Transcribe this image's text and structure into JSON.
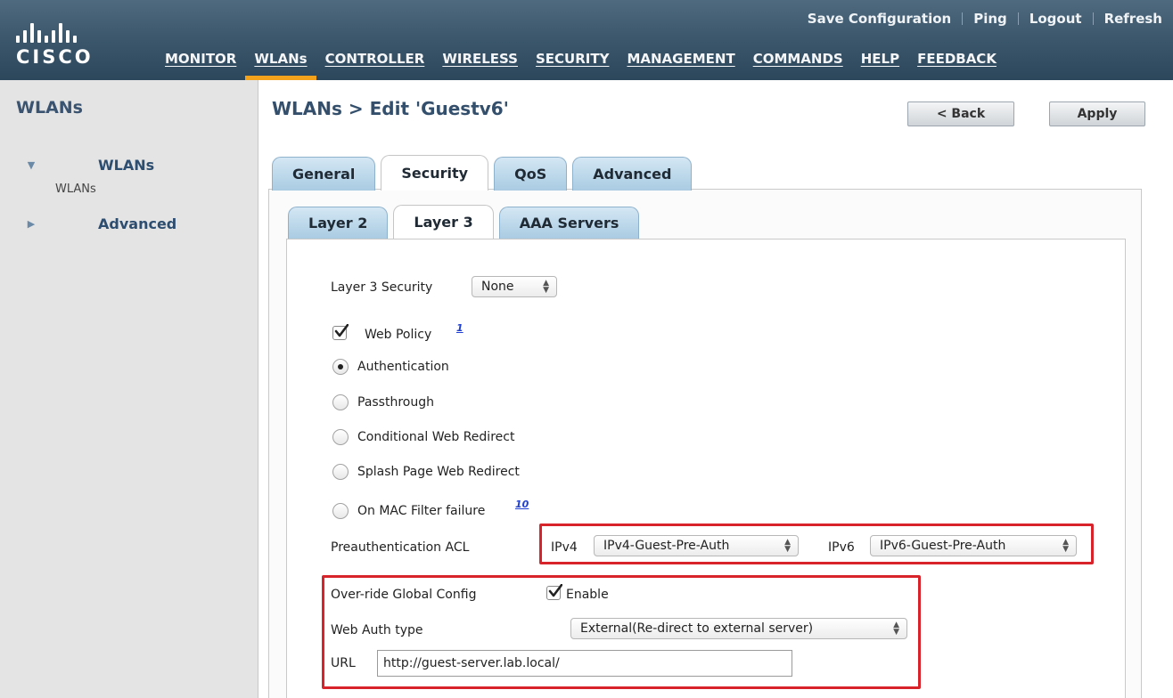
{
  "top_links": [
    "Save Configuration",
    "Ping",
    "Logout",
    "Refresh"
  ],
  "logo_text": "CISCO",
  "nav": [
    {
      "label": "MONITOR"
    },
    {
      "label": "WLANs"
    },
    {
      "label": "CONTROLLER"
    },
    {
      "label": "WIRELESS"
    },
    {
      "label": "SECURITY"
    },
    {
      "label": "MANAGEMENT"
    },
    {
      "label": "COMMANDS"
    },
    {
      "label": "HELP"
    },
    {
      "label": "FEEDBACK"
    }
  ],
  "nav_active": "WLANs",
  "sidebar": {
    "title": "WLANs",
    "items": [
      {
        "label": "WLANs",
        "sub": "WLANs",
        "expanded": true
      },
      {
        "label": "Advanced",
        "expanded": false
      }
    ]
  },
  "page": {
    "title": "WLANs > Edit  'Guestv6'",
    "back_button": "< Back",
    "apply_button": "Apply"
  },
  "tabs": [
    "General",
    "Security",
    "QoS",
    "Advanced"
  ],
  "active_tab": "Security",
  "subtabs": [
    "Layer 2",
    "Layer 3",
    "AAA Servers"
  ],
  "active_subtab": "Layer 3",
  "form": {
    "layer3_security_label": "Layer 3 Security",
    "layer3_security_value": "None",
    "web_policy_label": "Web Policy",
    "web_policy_checked": true,
    "web_policy_note": "1",
    "options": [
      {
        "label": "Authentication",
        "selected": true
      },
      {
        "label": "Passthrough",
        "selected": false
      },
      {
        "label": "Conditional Web Redirect",
        "selected": false
      },
      {
        "label": "Splash Page Web Redirect",
        "selected": false
      },
      {
        "label": "On MAC Filter failure",
        "selected": false,
        "note": "10"
      }
    ],
    "preauth_label": "Preauthentication ACL",
    "ipv4_label": "IPv4",
    "ipv4_value": "IPv4-Guest-Pre-Auth",
    "ipv6_label": "IPv6",
    "ipv6_value": "IPv6-Guest-Pre-Auth",
    "override_label": "Over-ride Global Config",
    "override_checked": true,
    "enable_label": "Enable",
    "web_auth_label": "Web Auth type",
    "web_auth_value": "External(Re-direct to external server)",
    "url_label": "URL",
    "url_value": "http://guest-server.lab.local/"
  },
  "colors": {
    "header_blue": "#3d586d",
    "nav_active_underline": "#f3a21c",
    "title_blue": "#344f6c",
    "tab_blue": "#b8d6ea",
    "highlight_red": "#d8232a",
    "link_blue": "#1f3fd0"
  }
}
